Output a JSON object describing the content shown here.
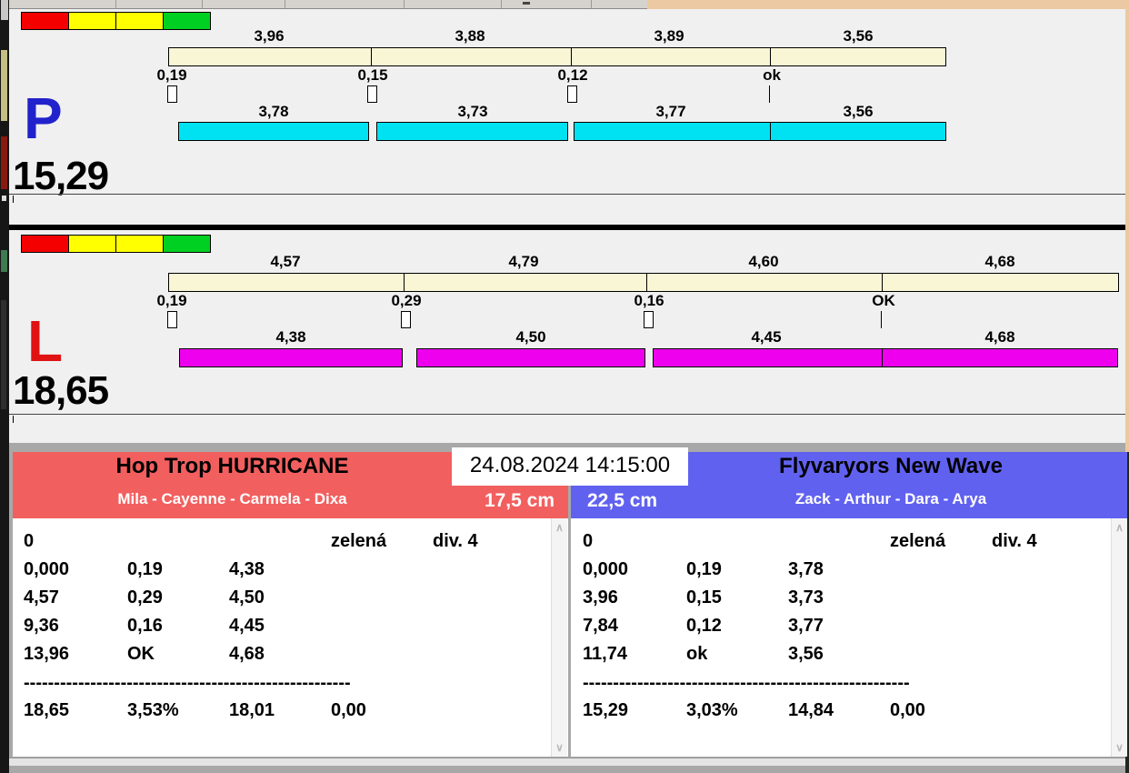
{
  "icons": {
    "scroll_up": "∧",
    "scroll_down": "∨"
  },
  "colors": {
    "panel_bg": "#f0f0f0",
    "split_top_bar": "#f9f6d6",
    "lane_p_bar": "#00e2f2",
    "lane_l_bar": "#ee00ee",
    "team_left_header": "#f25f5f",
    "team_right_header": "#6161f0",
    "tree_lights": [
      "#f40000",
      "#ffff00",
      "#ffff00",
      "#00d022"
    ]
  },
  "clock": "24.08.2024 14:15:00",
  "lanes": [
    {
      "letter": "P",
      "letter_color": "#2222cc",
      "total": "15,29",
      "splits_top": [
        "3,96",
        "3,88",
        "3,89",
        "3,56"
      ],
      "ticks": [
        "0,19",
        "0,15",
        "0,12",
        "ok"
      ],
      "splits_bottom": [
        "3,78",
        "3,73",
        "3,77",
        "3,56"
      ],
      "bar_color": "#00e2f2"
    },
    {
      "letter": "L",
      "letter_color": "#e01212",
      "total": "18,65",
      "splits_top": [
        "4,57",
        "4,79",
        "4,60",
        "4,68"
      ],
      "ticks": [
        "0,19",
        "0,29",
        "0,16",
        "OK"
      ],
      "splits_bottom": [
        "4,38",
        "4,50",
        "4,45",
        "4,68"
      ],
      "bar_color": "#ee00ee"
    }
  ],
  "teams": [
    {
      "name": "Hop Trop HURRICANE",
      "dogs": "Mila - Cayenne - Carmela - Dixa",
      "jump_height": "17,5 cm",
      "header_color": "#f25f5f",
      "log": {
        "head": [
          "0",
          "zelená",
          "div. 4"
        ],
        "rows": [
          [
            "0,000",
            "0,19",
            "4,38"
          ],
          [
            "4,57",
            "0,29",
            "4,50"
          ],
          [
            "9,36",
            "0,16",
            "4,45"
          ],
          [
            "13,96",
            "OK",
            "4,68"
          ]
        ],
        "divider": "------------------------------------------------------",
        "totals": [
          "18,65",
          "3,53%",
          "18,01",
          "0,00"
        ]
      }
    },
    {
      "name": "Flyvaryors New Wave",
      "dogs": "Zack - Arthur - Dara - Arya",
      "jump_height": "22,5 cm",
      "header_color": "#6161f0",
      "log": {
        "head": [
          "0",
          "zelená",
          "div. 4"
        ],
        "rows": [
          [
            "0,000",
            "0,19",
            "3,78"
          ],
          [
            "3,96",
            "0,15",
            "3,73"
          ],
          [
            "7,84",
            "0,12",
            "3,77"
          ],
          [
            "11,74",
            "ok",
            "3,56"
          ]
        ],
        "divider": "------------------------------------------------------",
        "totals": [
          "15,29",
          "3,03%",
          "14,84",
          "0,00"
        ]
      }
    }
  ]
}
